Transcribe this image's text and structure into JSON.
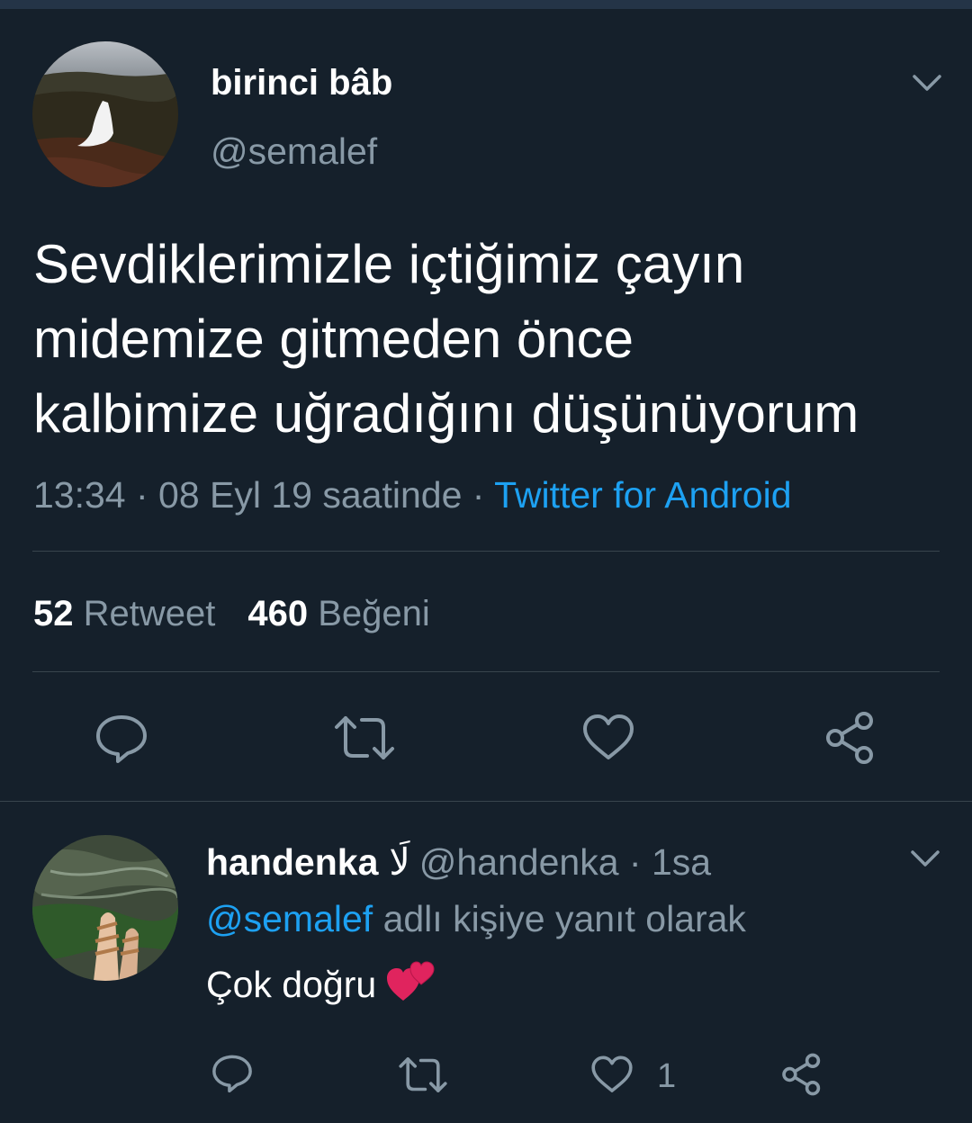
{
  "tweet": {
    "author_name": "birinci bâb",
    "author_handle": "@semalef",
    "text": "Sevdiklerimizle içtiğimiz çayın\nmidemize gitmeden önce\nkalbimize uğradığını düşünüyorum",
    "timestamp": "13:34 · 08 Eyl 19 saatinde",
    "separator": " · ",
    "source": "Twitter for Android",
    "retweet_count": "52",
    "retweet_label": "Retweet",
    "like_count": "460",
    "like_label": "Beğeni",
    "icons": [
      "reply-icon",
      "retweet-icon",
      "like-icon",
      "share-icon",
      "chevron-down-icon"
    ]
  },
  "reply": {
    "author_name": "handenka",
    "name_symbol": "لَا",
    "author_handle": "@handenka · 1sa",
    "reply_to_mention": "@semalef",
    "reply_to_suffix": " adlı kişiye yanıt olarak",
    "text": "Çok doğru",
    "emoji": "two-hearts-emoji",
    "like_count": "1"
  },
  "colors": {
    "background": "#15202b",
    "text": "#ffffff",
    "secondary": "#8899a6",
    "accent": "#1da1f2",
    "divider": "#38444d"
  }
}
